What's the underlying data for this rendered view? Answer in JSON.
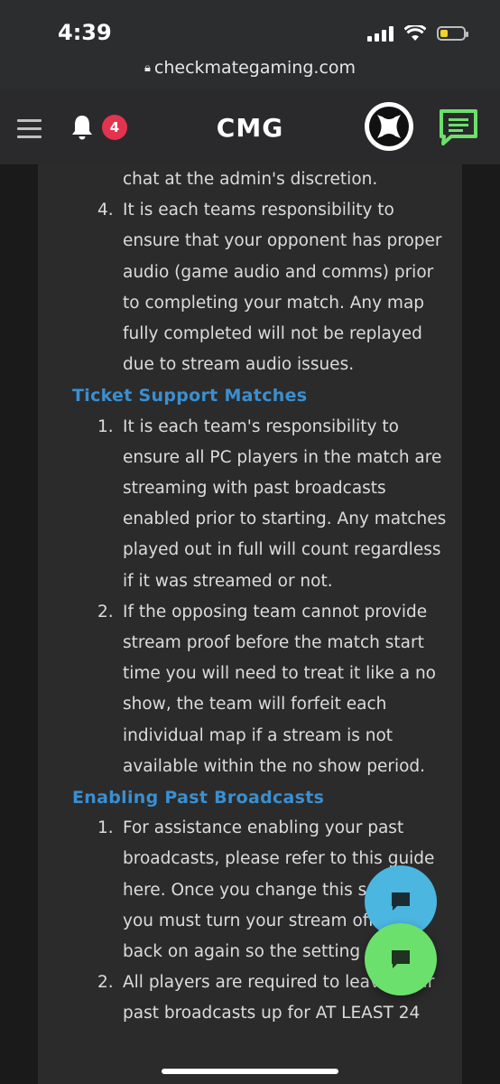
{
  "status": {
    "time": "4:39"
  },
  "browser": {
    "url": "checkmategaming.com"
  },
  "header": {
    "notification_count": "4",
    "logo_text": "CMG"
  },
  "colors": {
    "accent": "#3a8fd1",
    "badge": "#e3334f",
    "fab_blue": "#4bb6e0",
    "fab_green": "#6ce06c"
  },
  "content": {
    "top_fragment": "chat at the admin's discretion.",
    "item4": {
      "num": "4.",
      "text": "It is each teams responsibility to ensure that your opponent has proper audio (game audio and comms) prior to completing your match. Any map fully completed will not be replayed due to stream audio issues."
    },
    "section1": {
      "heading": "Ticket Support Matches",
      "items": [
        {
          "num": "1.",
          "text": "It is each team's responsibility to ensure all PC players in the match are streaming with past broadcasts enabled prior to starting. Any matches played out in full will count regardless if it was streamed or not."
        },
        {
          "num": "2.",
          "text": "If the opposing team cannot provide stream proof before the match start time you will need to treat it like a no show, the team will forfeit each individual map if a stream is not available within the no show period."
        }
      ]
    },
    "section2": {
      "heading": "Enabling Past Broadcasts",
      "items": [
        {
          "num": "1.",
          "text": "For assistance enabling your past broadcasts, please refer to this guide here. Once you change this setting you must turn your stream off and back on again so the setting saves."
        },
        {
          "num": "2.",
          "text": "All players are required to leave their past broadcasts up for AT LEAST 24"
        }
      ]
    }
  }
}
